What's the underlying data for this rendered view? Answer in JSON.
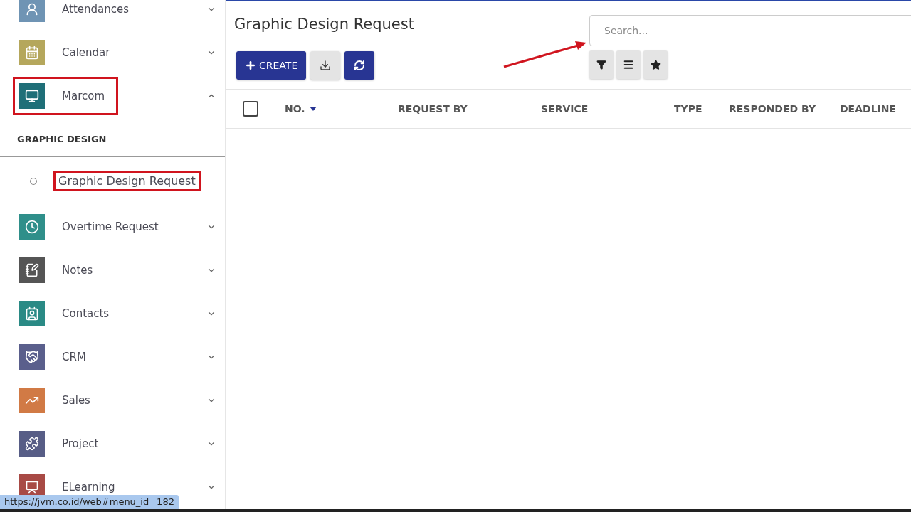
{
  "sidebar": {
    "items": [
      {
        "kind": "module",
        "label": "Attendances",
        "color": "#6f94b4",
        "expanded": false,
        "highlighted": false
      },
      {
        "kind": "module",
        "label": "Calendar",
        "color": "#b5a75c",
        "expanded": false,
        "highlighted": false
      },
      {
        "kind": "module",
        "label": "Marcom",
        "color": "#1f6f78",
        "expanded": true,
        "highlighted": true
      },
      {
        "kind": "section",
        "label": "GRAPHIC DESIGN"
      },
      {
        "kind": "link",
        "label": "Graphic Design Request",
        "highlighted": true
      },
      {
        "kind": "module",
        "label": "Overtime Request",
        "color": "#2f8f8a",
        "expanded": false,
        "highlighted": false
      },
      {
        "kind": "module",
        "label": "Notes",
        "color": "#555555",
        "expanded": false,
        "highlighted": false
      },
      {
        "kind": "module",
        "label": "Contacts",
        "color": "#2a8a85",
        "expanded": false,
        "highlighted": false
      },
      {
        "kind": "module",
        "label": "CRM",
        "color": "#5a5f8c",
        "expanded": false,
        "highlighted": false
      },
      {
        "kind": "module",
        "label": "Sales",
        "color": "#d17a45",
        "expanded": false,
        "highlighted": false
      },
      {
        "kind": "module",
        "label": "Project",
        "color": "#575d86",
        "expanded": false,
        "highlighted": false
      },
      {
        "kind": "module",
        "label": "ELearning",
        "color": "#a84a45",
        "expanded": false,
        "highlighted": false
      }
    ]
  },
  "page": {
    "title": "Graphic Design Request",
    "create_button": "CREATE"
  },
  "search": {
    "placeholder": "Search..."
  },
  "table": {
    "columns": [
      {
        "label": "NO.",
        "sorted": true
      },
      {
        "label": "REQUEST BY",
        "sorted": false
      },
      {
        "label": "SERVICE",
        "sorted": false
      },
      {
        "label": "TYPE",
        "sorted": false
      },
      {
        "label": "RESPONDED BY",
        "sorted": false
      },
      {
        "label": "DEADLINE",
        "sorted": false
      }
    ],
    "select_all_checked": false
  },
  "status_url": "https://jvm.co.id/web#menu_id=182"
}
